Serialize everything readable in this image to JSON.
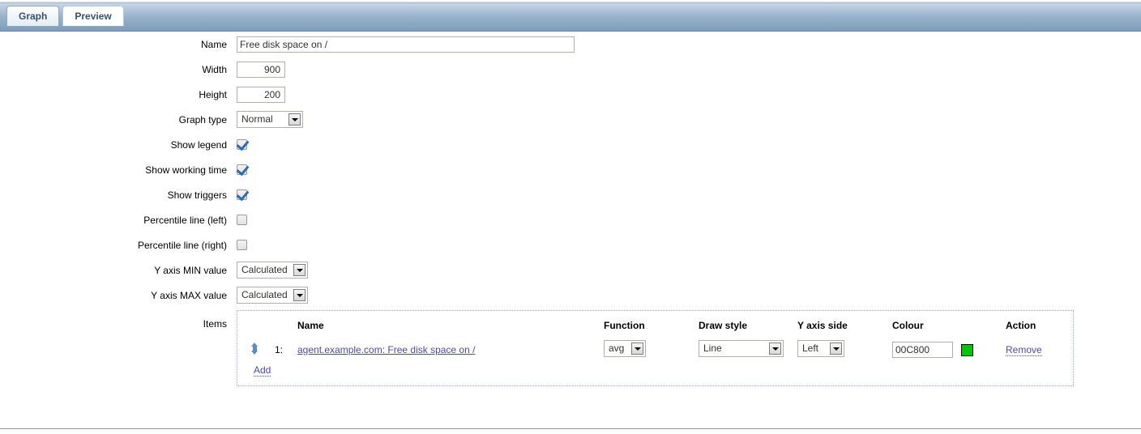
{
  "tabs": [
    {
      "label": "Graph",
      "active": true
    },
    {
      "label": "Preview",
      "active": false
    }
  ],
  "form": {
    "name": {
      "label": "Name",
      "value": "Free disk space on /"
    },
    "width": {
      "label": "Width",
      "value": "900"
    },
    "height": {
      "label": "Height",
      "value": "200"
    },
    "graph_type": {
      "label": "Graph type",
      "value": "Normal"
    },
    "show_legend": {
      "label": "Show legend",
      "checked": true
    },
    "show_working_time": {
      "label": "Show working time",
      "checked": true
    },
    "show_triggers": {
      "label": "Show triggers",
      "checked": true
    },
    "percentile_left": {
      "label": "Percentile line (left)",
      "checked": false
    },
    "percentile_right": {
      "label": "Percentile line (right)",
      "checked": false
    },
    "y_axis_min": {
      "label": "Y axis MIN value",
      "value": "Calculated"
    },
    "y_axis_max": {
      "label": "Y axis MAX value",
      "value": "Calculated"
    }
  },
  "items": {
    "label": "Items",
    "headers": {
      "name": "Name",
      "function": "Function",
      "draw_style": "Draw style",
      "y_axis_side": "Y axis side",
      "colour": "Colour",
      "action": "Action"
    },
    "rows": [
      {
        "index": "1:",
        "name": "agent.example.com: Free disk space on /",
        "function": "avg",
        "draw_style": "Line",
        "y_axis_side": "Left",
        "colour": "00C800",
        "colour_hex": "#00C800",
        "action": "Remove"
      }
    ],
    "add_label": "Add"
  }
}
